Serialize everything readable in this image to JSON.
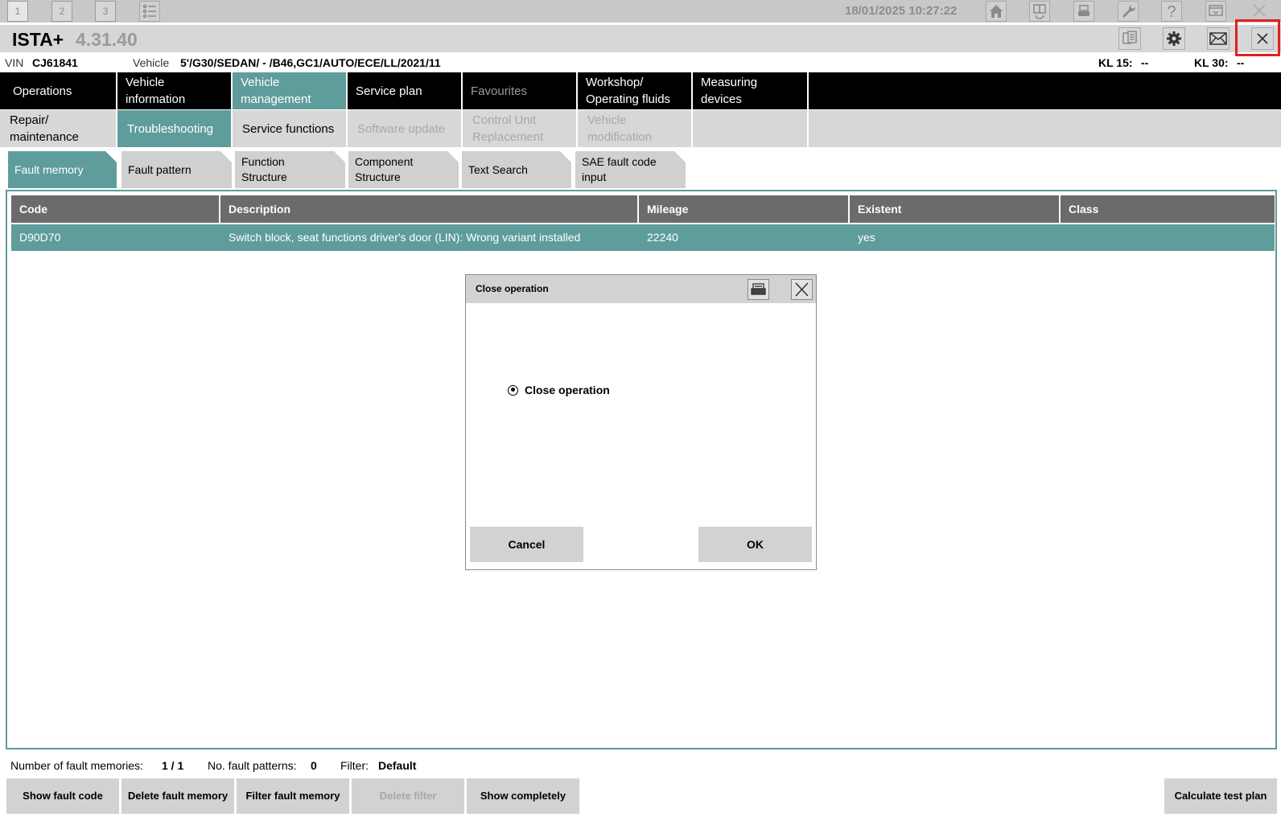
{
  "top_bar": {
    "workspace_tabs": [
      "1",
      "2",
      "3"
    ],
    "datetime": "18/01/2025 10:27:22",
    "icons": [
      "list-icon",
      "home-icon",
      "diagnosis-icon",
      "print-icon",
      "wrench-icon",
      "help-icon",
      "display-icon",
      "close-icon"
    ]
  },
  "title_bar": {
    "app_name": "ISTA+",
    "version": "4.31.40",
    "icons": [
      "documents-icon",
      "settings-gear-icon",
      "mail-icon",
      "close-icon"
    ],
    "highlight_color": "#e02020"
  },
  "vehicle_info": {
    "vin_label": "VIN",
    "vin": "CJ61841",
    "vehicle_label": "Vehicle",
    "vehicle": "5'/G30/SEDAN/ - /B46,GC1/AUTO/ECE/LL/2021/11",
    "kl15_label": "KL 15:",
    "kl15_value": "--",
    "kl30_label": "KL 30:",
    "kl30_value": "--"
  },
  "main_nav": {
    "operations": "Operations",
    "vehicle_information": "Vehicle information",
    "vehicle_management_1": "Vehicle",
    "vehicle_management_2": "management",
    "service_plan": "Service plan",
    "favourites": "Favourites",
    "workshop_1": "Workshop/",
    "workshop_2": "Operating fluids",
    "measuring_devices": "Measuring devices"
  },
  "sub_nav": {
    "repair_1": "Repair/",
    "repair_2": "maintenance",
    "troubleshooting": "Troubleshooting",
    "service_functions": "Service functions",
    "software_update": "Software update",
    "control_unit_1": "Control Unit",
    "control_unit_2": "Replacement",
    "vehicle_mod_1": "Vehicle",
    "vehicle_mod_2": "modification"
  },
  "tabs": {
    "fault_memory": "Fault memory",
    "fault_pattern": "Fault pattern",
    "function_structure_1": "Function",
    "function_structure_2": "Structure",
    "component_structure_1": "Component",
    "component_structure_2": "Structure",
    "text_search": "Text Search",
    "sae_1": "SAE fault code",
    "sae_2": "input"
  },
  "table": {
    "headers": [
      "Code",
      "Description",
      "Mileage",
      "Existent",
      "Class"
    ],
    "rows": [
      [
        "D90D70",
        "Switch block, seat functions driver's door (LIN): Wrong variant installed",
        "22240",
        "yes",
        ""
      ]
    ]
  },
  "dialog": {
    "title": "Close operation",
    "option_label": "Close operation",
    "cancel": "Cancel",
    "ok": "OK"
  },
  "status": {
    "fault_memories_label": "Number of fault memories:",
    "fault_memories_value": "1 / 1",
    "fault_patterns_label": "No. fault patterns:",
    "fault_patterns_value": "0",
    "filter_label": "Filter:",
    "filter_value": "Default"
  },
  "buttons": {
    "show_fault_code": "Show fault code",
    "delete_fault_memory": "Delete fault memory",
    "filter_fault_memory": "Filter fault memory",
    "delete_filter": "Delete filter",
    "show_completely": "Show completely",
    "calculate_test_plan": "Calculate test plan"
  },
  "colors": {
    "accent": "#5f9c9c",
    "nav_background": "#000000",
    "table_header": "#6b6b6b"
  }
}
